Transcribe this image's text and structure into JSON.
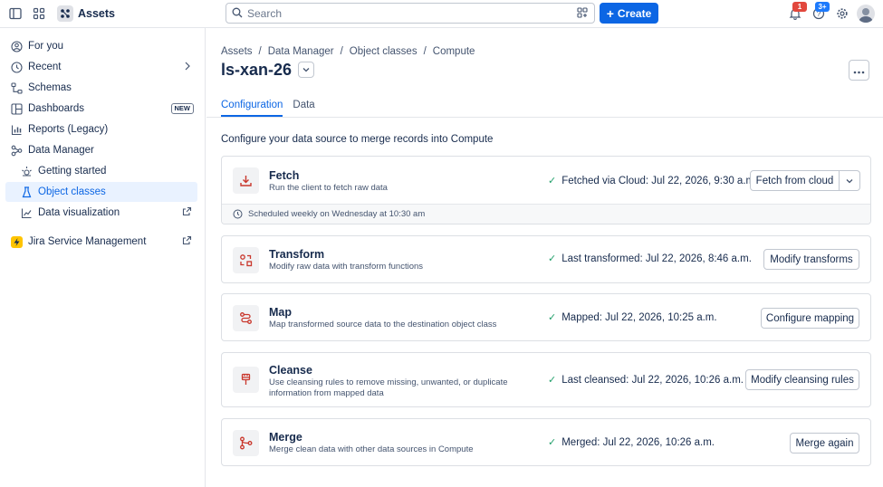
{
  "topbar": {
    "app_name": "Assets",
    "search_placeholder": "Search",
    "create_label": "Create",
    "notifications_badge": "1",
    "help_badge": "3+",
    "icons": [
      "sidebar-toggle-icon",
      "app-switcher-icon",
      "assets-logo-icon",
      "search-icon",
      "scan-icon",
      "plus-icon",
      "bell-icon",
      "help-icon",
      "gear-icon"
    ]
  },
  "sidebar": {
    "items": [
      {
        "label": "For you",
        "icon": "person-circle-icon"
      },
      {
        "label": "Recent",
        "icon": "clock-icon"
      },
      {
        "label": "Schemas",
        "icon": "schema-icon"
      },
      {
        "label": "Dashboards",
        "icon": "dashboard-icon",
        "lozenge": "NEW"
      },
      {
        "label": "Reports (Legacy)",
        "icon": "chart-icon"
      },
      {
        "label": "Data Manager",
        "icon": "data-manager-icon"
      },
      {
        "label": "Getting started",
        "icon": "sparkle-icon"
      },
      {
        "label": "Object classes",
        "icon": "flask-icon"
      },
      {
        "label": "Data visualization",
        "icon": "visualization-icon"
      },
      {
        "label": "Jira Service Management",
        "icon": "jsm-logo-icon"
      }
    ]
  },
  "main": {
    "breadcrumb": [
      "Assets",
      "Data Manager",
      "Object classes",
      "Compute"
    ],
    "breadcrumb_sep": "/",
    "title": "ls-xan-26",
    "tabs": [
      "Configuration",
      "Data"
    ],
    "intro": "Configure your data source to merge records into Compute",
    "steps": [
      {
        "title": "Fetch",
        "desc": "Run the client to fetch raw data",
        "status": "Fetched via Cloud: Jul 22, 2026, 9:30 a.m.",
        "action": "Fetch from cloud",
        "footer": "Scheduled weekly on Wednesday at 10:30 am",
        "icon": "download-icon"
      },
      {
        "title": "Transform",
        "desc": "Modify raw data with transform functions",
        "status": "Last transformed: Jul 22, 2026, 8:46 a.m.",
        "action": "Modify transforms",
        "icon": "transform-icon"
      },
      {
        "title": "Map",
        "desc": "Map transformed source data to the destination object class",
        "status": "Mapped: Jul 22, 2026, 10:25 a.m.",
        "action": "Configure mapping",
        "icon": "map-route-icon"
      },
      {
        "title": "Cleanse",
        "desc": "Use cleansing rules to remove missing, unwanted, or duplicate information from mapped data",
        "status": "Last cleansed: Jul 22, 2026, 10:26 a.m.",
        "action": "Modify cleansing rules",
        "icon": "brush-icon"
      },
      {
        "title": "Merge",
        "desc": "Merge clean data with other data sources in Compute",
        "status": "Merged: Jul 22, 2026, 10:26 a.m.",
        "action": "Merge again",
        "icon": "merge-icon"
      }
    ]
  },
  "colors": {
    "accent": "#0c66e4",
    "step_icon": "#c9372c",
    "success": "#22a06b",
    "badge_red": "#e2483d",
    "badge_blue": "#1d7afc"
  }
}
